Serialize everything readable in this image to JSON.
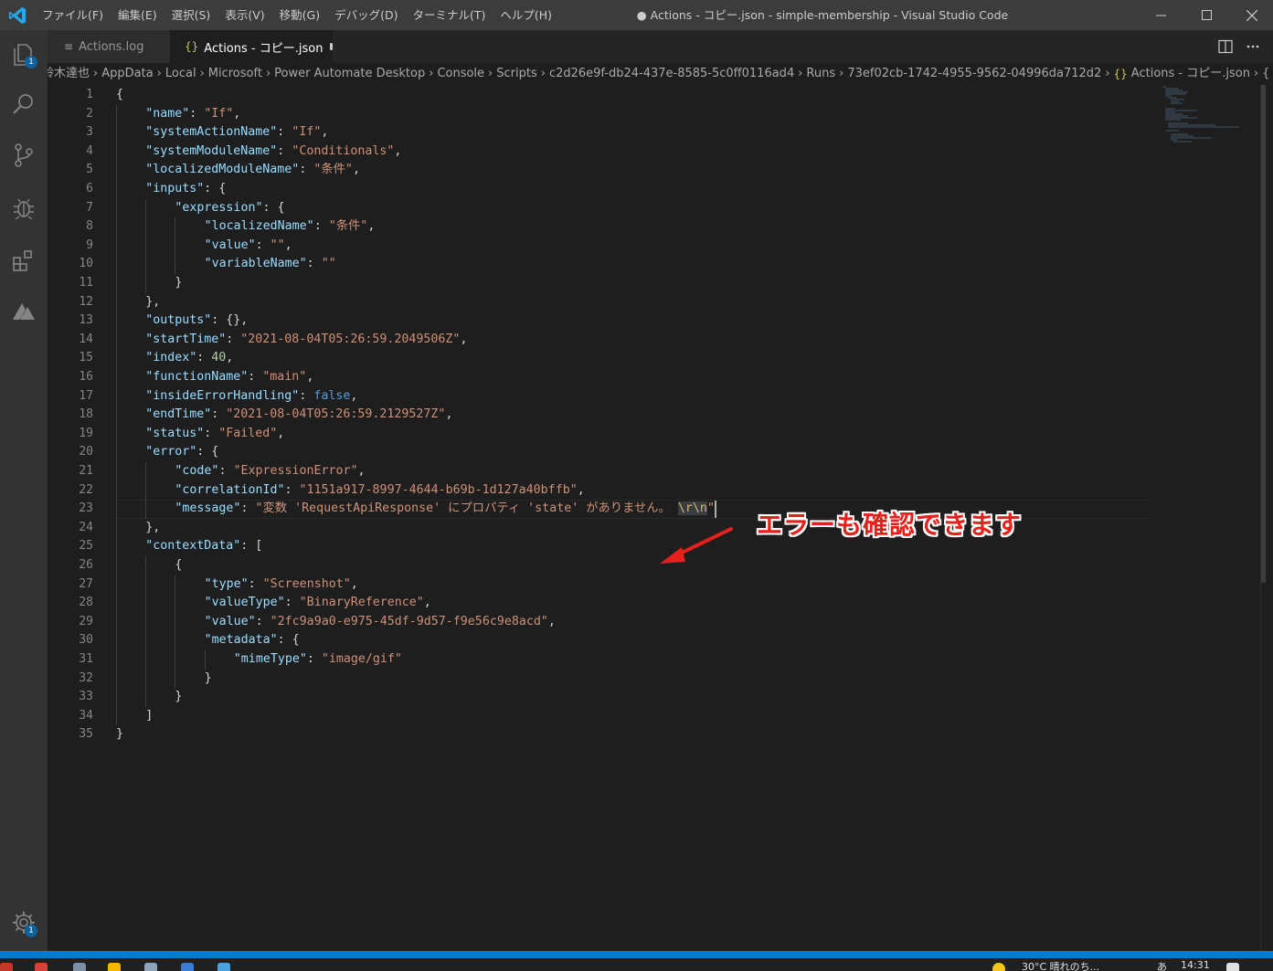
{
  "app": {
    "window_title": "● Actions - コピー.json - simple-membership - Visual Studio Code",
    "menu": [
      "ファイル(F)",
      "編集(E)",
      "選択(S)",
      "表示(V)",
      "移動(G)",
      "デバッグ(D)",
      "ターミナル(T)",
      "ヘルプ(H)"
    ]
  },
  "activity": {
    "explorer_badge": "1",
    "settings_badge": "1"
  },
  "tabs": [
    {
      "label": "Actions.log",
      "active": false,
      "icon": "log-file-icon"
    },
    {
      "label": "Actions - コピー.json",
      "active": true,
      "dirty": true,
      "icon": "json-file-icon"
    }
  ],
  "breadcrumb": [
    "鈴木達也",
    "AppData",
    "Local",
    "Microsoft",
    "Power Automate Desktop",
    "Console",
    "Scripts",
    "c2d26e9f-db24-437e-8585-5c0ff0116ad4",
    "Runs",
    "73ef02cb-1742-4955-9562-04996da712d2",
    "Actions - コピー.json",
    "{"
  ],
  "editor": {
    "line_numbers": [
      "1",
      "2",
      "3",
      "4",
      "5",
      "6",
      "7",
      "8",
      "9",
      "10",
      "11",
      "12",
      "13",
      "14",
      "15",
      "16",
      "17",
      "18",
      "19",
      "20",
      "21",
      "22",
      "23",
      "24",
      "25",
      "26",
      "27",
      "28",
      "29",
      "30",
      "31",
      "32",
      "33",
      "34",
      "35"
    ],
    "lines": [
      {
        "indent": 0,
        "tokens": [
          [
            "p",
            "{"
          ]
        ]
      },
      {
        "indent": 1,
        "tokens": [
          [
            "k",
            "\"name\""
          ],
          [
            "p",
            ": "
          ],
          [
            "s",
            "\"If\""
          ],
          [
            "p",
            ","
          ]
        ]
      },
      {
        "indent": 1,
        "tokens": [
          [
            "k",
            "\"systemActionName\""
          ],
          [
            "p",
            ": "
          ],
          [
            "s",
            "\"If\""
          ],
          [
            "p",
            ","
          ]
        ]
      },
      {
        "indent": 1,
        "tokens": [
          [
            "k",
            "\"systemModuleName\""
          ],
          [
            "p",
            ": "
          ],
          [
            "s",
            "\"Conditionals\""
          ],
          [
            "p",
            ","
          ]
        ]
      },
      {
        "indent": 1,
        "tokens": [
          [
            "k",
            "\"localizedModuleName\""
          ],
          [
            "p",
            ": "
          ],
          [
            "s",
            "\"条件\""
          ],
          [
            "p",
            ","
          ]
        ]
      },
      {
        "indent": 1,
        "tokens": [
          [
            "k",
            "\"inputs\""
          ],
          [
            "p",
            ": {"
          ]
        ]
      },
      {
        "indent": 2,
        "tokens": [
          [
            "k",
            "\"expression\""
          ],
          [
            "p",
            ": {"
          ]
        ]
      },
      {
        "indent": 3,
        "tokens": [
          [
            "k",
            "\"localizedName\""
          ],
          [
            "p",
            ": "
          ],
          [
            "s",
            "\"条件\""
          ],
          [
            "p",
            ","
          ]
        ]
      },
      {
        "indent": 3,
        "tokens": [
          [
            "k",
            "\"value\""
          ],
          [
            "p",
            ": "
          ],
          [
            "s",
            "\"\""
          ],
          [
            "p",
            ","
          ]
        ]
      },
      {
        "indent": 3,
        "tokens": [
          [
            "k",
            "\"variableName\""
          ],
          [
            "p",
            ": "
          ],
          [
            "s",
            "\"\""
          ]
        ]
      },
      {
        "indent": 2,
        "tokens": [
          [
            "p",
            "}"
          ]
        ]
      },
      {
        "indent": 1,
        "tokens": [
          [
            "p",
            "},"
          ]
        ]
      },
      {
        "indent": 1,
        "tokens": [
          [
            "k",
            "\"outputs\""
          ],
          [
            "p",
            ": {},"
          ]
        ]
      },
      {
        "indent": 1,
        "tokens": [
          [
            "k",
            "\"startTime\""
          ],
          [
            "p",
            ": "
          ],
          [
            "s",
            "\"2021-08-04T05:26:59.2049506Z\""
          ],
          [
            "p",
            ","
          ]
        ]
      },
      {
        "indent": 1,
        "tokens": [
          [
            "k",
            "\"index\""
          ],
          [
            "p",
            ": "
          ],
          [
            "n",
            "40"
          ],
          [
            "p",
            ","
          ]
        ]
      },
      {
        "indent": 1,
        "tokens": [
          [
            "k",
            "\"functionName\""
          ],
          [
            "p",
            ": "
          ],
          [
            "s",
            "\"main\""
          ],
          [
            "p",
            ","
          ]
        ]
      },
      {
        "indent": 1,
        "tokens": [
          [
            "k",
            "\"insideErrorHandling\""
          ],
          [
            "p",
            ": "
          ],
          [
            "b",
            "false"
          ],
          [
            "p",
            ","
          ]
        ]
      },
      {
        "indent": 1,
        "tokens": [
          [
            "k",
            "\"endTime\""
          ],
          [
            "p",
            ": "
          ],
          [
            "s",
            "\"2021-08-04T05:26:59.2129527Z\""
          ],
          [
            "p",
            ","
          ]
        ]
      },
      {
        "indent": 1,
        "tokens": [
          [
            "k",
            "\"status\""
          ],
          [
            "p",
            ": "
          ],
          [
            "s",
            "\"Failed\""
          ],
          [
            "p",
            ","
          ]
        ]
      },
      {
        "indent": 1,
        "tokens": [
          [
            "k",
            "\"error\""
          ],
          [
            "p",
            ": {"
          ]
        ]
      },
      {
        "indent": 2,
        "tokens": [
          [
            "k",
            "\"code\""
          ],
          [
            "p",
            ": "
          ],
          [
            "s",
            "\"ExpressionError\""
          ],
          [
            "p",
            ","
          ]
        ]
      },
      {
        "indent": 2,
        "tokens": [
          [
            "k",
            "\"correlationId\""
          ],
          [
            "p",
            ": "
          ],
          [
            "s",
            "\"1151a917-8997-4644-b69b-1d127a40bffb\""
          ],
          [
            "p",
            ","
          ]
        ]
      },
      {
        "indent": 2,
        "tokens": [
          [
            "k",
            "\"message\""
          ],
          [
            "p",
            ": "
          ],
          [
            "s",
            "\"変数 'RequestApiResponse' にプロパティ 'state' がありません。 "
          ],
          [
            "x",
            "\\r\\n"
          ],
          [
            "s",
            "\""
          ]
        ]
      },
      {
        "indent": 1,
        "tokens": [
          [
            "p",
            "},"
          ]
        ]
      },
      {
        "indent": 1,
        "tokens": [
          [
            "k",
            "\"contextData\""
          ],
          [
            "p",
            ": ["
          ]
        ]
      },
      {
        "indent": 2,
        "tokens": [
          [
            "p",
            "{"
          ]
        ]
      },
      {
        "indent": 3,
        "tokens": [
          [
            "k",
            "\"type\""
          ],
          [
            "p",
            ": "
          ],
          [
            "s",
            "\"Screenshot\""
          ],
          [
            "p",
            ","
          ]
        ]
      },
      {
        "indent": 3,
        "tokens": [
          [
            "k",
            "\"valueType\""
          ],
          [
            "p",
            ": "
          ],
          [
            "s",
            "\"BinaryReference\""
          ],
          [
            "p",
            ","
          ]
        ]
      },
      {
        "indent": 3,
        "tokens": [
          [
            "k",
            "\"value\""
          ],
          [
            "p",
            ": "
          ],
          [
            "s",
            "\"2fc9a9a0-e975-45df-9d57-f9e56c9e8acd\""
          ],
          [
            "p",
            ","
          ]
        ]
      },
      {
        "indent": 3,
        "tokens": [
          [
            "k",
            "\"metadata\""
          ],
          [
            "p",
            ": {"
          ]
        ]
      },
      {
        "indent": 4,
        "tokens": [
          [
            "k",
            "\"mimeType\""
          ],
          [
            "p",
            ": "
          ],
          [
            "s",
            "\"image/gif\""
          ]
        ]
      },
      {
        "indent": 3,
        "tokens": [
          [
            "p",
            "}"
          ]
        ]
      },
      {
        "indent": 2,
        "tokens": [
          [
            "p",
            "}"
          ]
        ]
      },
      {
        "indent": 1,
        "tokens": [
          [
            "p",
            "]"
          ]
        ]
      },
      {
        "indent": 0,
        "tokens": [
          [
            "p",
            "}"
          ]
        ]
      }
    ],
    "current_line": 23
  },
  "annotation": {
    "text": "エラーも確認できます",
    "color": "#e6201c"
  },
  "taskbar": {
    "weather": "30°C 晴れのち...",
    "ime": "あ",
    "time": "14:31"
  },
  "colors": {
    "titlebar": "#3c3c3c",
    "activitybar": "#333333",
    "editor_bg": "#1e1e1e",
    "statusbar": "#007acc",
    "json_key": "#9cdcfe",
    "json_string": "#ce9178",
    "json_number": "#b5cea8",
    "json_boolean": "#569cd6"
  }
}
